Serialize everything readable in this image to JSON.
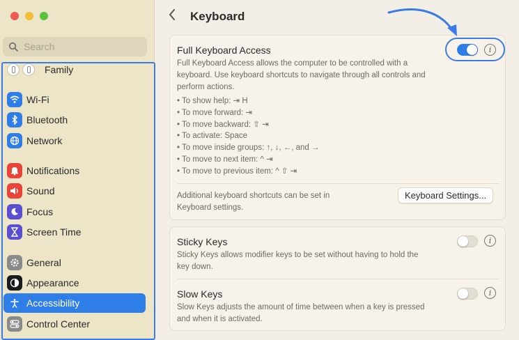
{
  "window": {
    "title": "Keyboard",
    "search_placeholder": "Search"
  },
  "sidebar": {
    "family_label": "Family",
    "items": [
      {
        "label": "Wi-Fi",
        "icon": "wifi-icon",
        "color": "#2f7ee8"
      },
      {
        "label": "Bluetooth",
        "icon": "bluetooth-icon",
        "color": "#2f7ee8"
      },
      {
        "label": "Network",
        "icon": "globe-icon",
        "color": "#2f7ee8"
      },
      {
        "label": "Notifications",
        "icon": "bell-icon",
        "color": "#e8443a"
      },
      {
        "label": "Sound",
        "icon": "speaker-icon",
        "color": "#e8443a"
      },
      {
        "label": "Focus",
        "icon": "moon-icon",
        "color": "#5a4fd1"
      },
      {
        "label": "Screen Time",
        "icon": "hourglass-icon",
        "color": "#5a4fd1"
      },
      {
        "label": "General",
        "icon": "gear-icon",
        "color": "#8a8a8a"
      },
      {
        "label": "Appearance",
        "icon": "appearance-icon",
        "color": "#1a1a1a"
      },
      {
        "label": "Accessibility",
        "icon": "accessibility-icon",
        "color": "#2f7ee8",
        "active": true
      },
      {
        "label": "Control Center",
        "icon": "control-center-icon",
        "color": "#8a8a8a"
      }
    ]
  },
  "fka": {
    "heading": "Full Keyboard Access",
    "toggle_on": true,
    "desc_lines": [
      "Full Keyboard Access allows the computer to be controlled with a",
      "keyboard. Use keyboard shortcuts to navigate through all controls and",
      "perform actions."
    ],
    "bullets": [
      "• To show help: ⇥ H",
      "• To move forward: ⇥",
      "• To move backward: ⇧ ⇥",
      "• To activate: Space",
      "• To move inside groups: ↑, ↓, ←, and →",
      "• To move to next item: ^ ⇥",
      "• To move to previous item: ^ ⇧ ⇥"
    ],
    "additional_lines": [
      "Additional keyboard shortcuts can be set in",
      "Keyboard settings."
    ],
    "button_label": "Keyboard Settings..."
  },
  "sticky": {
    "heading": "Sticky Keys",
    "toggle_on": false,
    "desc_lines": [
      "Sticky Keys allows modifier keys to be set without having to hold the",
      "key down."
    ]
  },
  "slow": {
    "heading": "Slow Keys",
    "toggle_on": false,
    "desc_lines": [
      "Slow Keys adjusts the amount of time between when a key is pressed",
      "and when it is activated."
    ]
  },
  "colors": {
    "accent": "#2f7ee8",
    "annotation": "#3b7be8"
  }
}
